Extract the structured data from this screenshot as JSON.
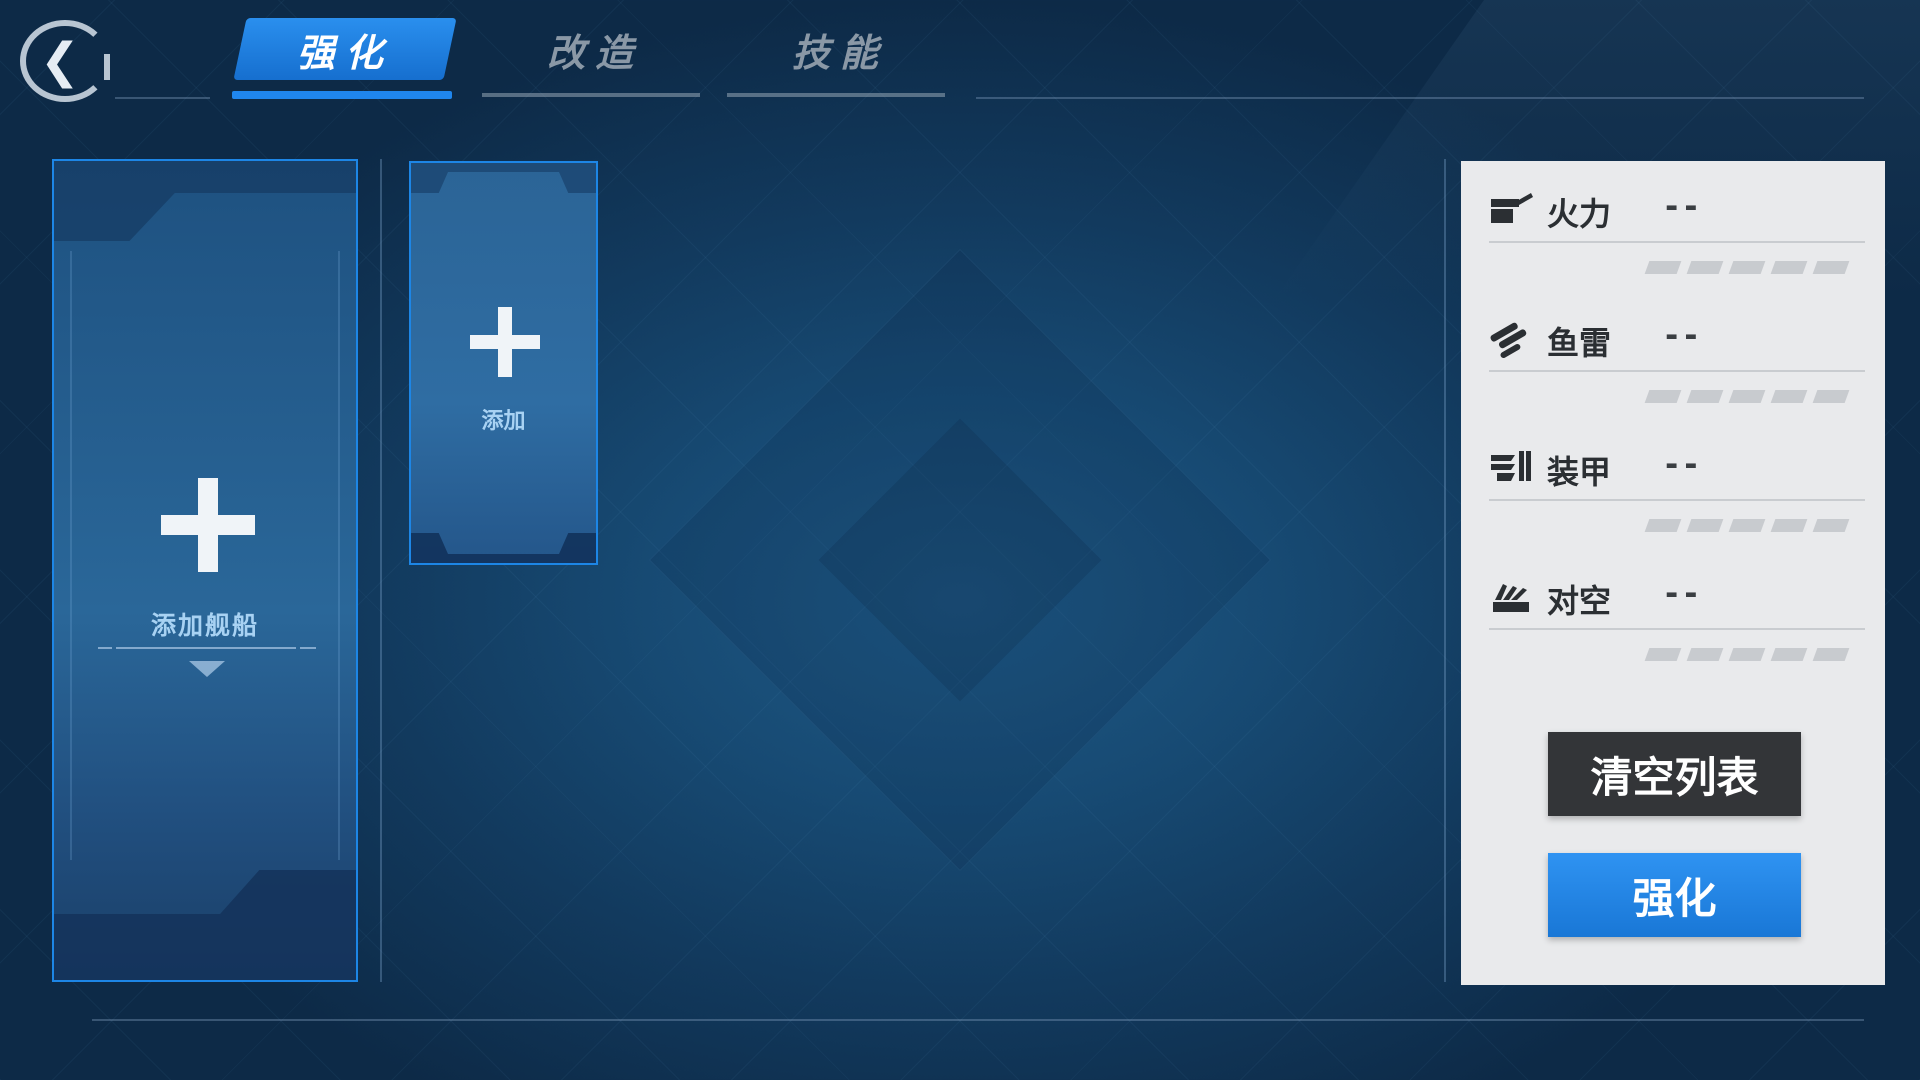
{
  "tabs": [
    {
      "label": "强化",
      "active": true
    },
    {
      "label": "改造",
      "active": false
    },
    {
      "label": "技能",
      "active": false
    }
  ],
  "ship_slot": {
    "label": "添加舰船"
  },
  "add_slot": {
    "label": "添加"
  },
  "stats": [
    {
      "icon": "cannon-icon",
      "name": "火力",
      "value": "--"
    },
    {
      "icon": "torpedo-icon",
      "name": "鱼雷",
      "value": "--"
    },
    {
      "icon": "armor-icon",
      "name": "装甲",
      "value": "--"
    },
    {
      "icon": "anti-air-icon",
      "name": "对空",
      "value": "--"
    }
  ],
  "buttons": {
    "clear_label": "清空列表",
    "enhance_label": "强化"
  },
  "colors": {
    "accent": "#1f86ee",
    "panel_bg": "#e9eaec",
    "dark_button": "#333538"
  }
}
